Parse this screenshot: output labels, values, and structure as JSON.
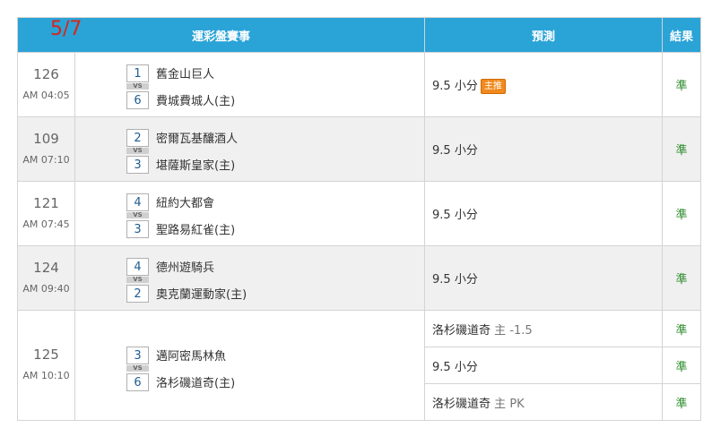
{
  "date_mark": "5/7",
  "headers": {
    "match": "運彩盤賽事",
    "prediction": "預測",
    "result": "結果"
  },
  "vs_label": "VS",
  "games": [
    {
      "id": "126",
      "time": "AM 04:05",
      "away_no": "1",
      "away": "舊金山巨人",
      "home_no": "6",
      "home": "費城費城人(主)",
      "preds": [
        {
          "text": "9.5 小分",
          "tag": "主推",
          "result": "準"
        }
      ]
    },
    {
      "id": "109",
      "time": "AM 07:10",
      "away_no": "2",
      "away": "密爾瓦基釀酒人",
      "home_no": "3",
      "home": "堪薩斯皇家(主)",
      "preds": [
        {
          "text": "9.5 小分",
          "result": "準"
        }
      ]
    },
    {
      "id": "121",
      "time": "AM 07:45",
      "away_no": "4",
      "away": "紐約大都會",
      "home_no": "3",
      "home": "聖路易紅雀(主)",
      "preds": [
        {
          "text": "9.5 小分",
          "result": "準"
        }
      ]
    },
    {
      "id": "124",
      "time": "AM 09:40",
      "away_no": "4",
      "away": "德州遊騎兵",
      "home_no": "2",
      "home": "奧克蘭運動家(主)",
      "preds": [
        {
          "text": "9.5 小分",
          "result": "準"
        }
      ]
    },
    {
      "id": "125",
      "time": "AM 10:10",
      "away_no": "3",
      "away": "邁阿密馬林魚",
      "home_no": "6",
      "home": "洛杉磯道奇(主)",
      "preds": [
        {
          "team": "洛杉磯道奇",
          "side": "主",
          "line": "-1.5",
          "result": "準"
        },
        {
          "text": "9.5 小分",
          "result": "準"
        },
        {
          "team": "洛杉磯道奇",
          "side": "主",
          "line": "PK",
          "result": "準"
        }
      ]
    }
  ]
}
